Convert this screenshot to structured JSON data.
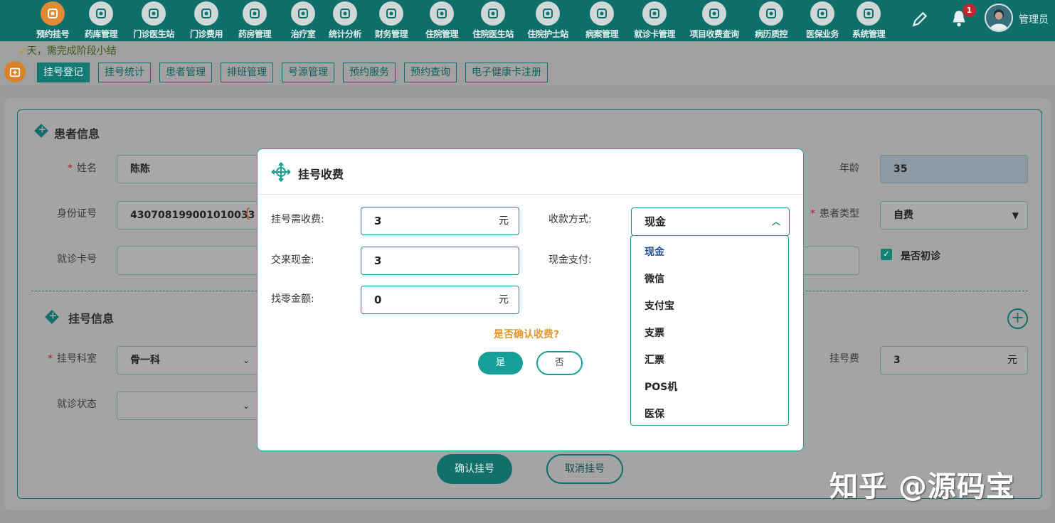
{
  "nav": {
    "items": [
      {
        "label": "预约挂号",
        "icon": "calendar-icon",
        "active": true
      },
      {
        "label": "药库管理",
        "icon": "warehouse-icon"
      },
      {
        "label": "门诊医生站",
        "icon": "doctor-icon"
      },
      {
        "label": "门诊费用",
        "icon": "yen-icon"
      },
      {
        "label": "药房管理",
        "icon": "pill-icon"
      },
      {
        "label": "治疗室",
        "icon": "nurse-icon"
      },
      {
        "label": "统计分析",
        "icon": "bar-chart-icon"
      },
      {
        "label": "财务管理",
        "icon": "gear-coin-icon"
      },
      {
        "label": "住院管理",
        "icon": "bed-icon"
      },
      {
        "label": "住院医生站",
        "icon": "doctor-card-icon"
      },
      {
        "label": "住院护士站",
        "icon": "nurse-card-icon"
      },
      {
        "label": "病案管理",
        "icon": "record-icon"
      },
      {
        "label": "就诊卡管理",
        "icon": "card-icon"
      },
      {
        "label": "项目收费查询",
        "icon": "bill-icon"
      },
      {
        "label": "病历质控",
        "icon": "quality-icon"
      },
      {
        "label": "医保业务",
        "icon": "insurance-icon"
      },
      {
        "label": "系统管理",
        "icon": "settings-icon"
      }
    ],
    "notification_count": "1",
    "user_name": "管理员"
  },
  "notice": "天，需完成阶段小结",
  "sub_tabs": [
    "挂号登记",
    "挂号统计",
    "患者管理",
    "排班管理",
    "号源管理",
    "预约服务",
    "预约查询",
    "电子健康卡注册"
  ],
  "patient": {
    "section_title": "患者信息",
    "name_label": "姓名",
    "name_value": "陈陈",
    "idcard_label": "身份证号",
    "idcard_value": "430708199001010033",
    "card_label": "就诊卡号",
    "card_value": "",
    "age_label": "年龄",
    "age_value": "35",
    "type_label": "患者类型",
    "type_value": "自费",
    "first_visit_label": "是否初诊",
    "first_visit_checked": true
  },
  "registration": {
    "section_title": "挂号信息",
    "dept_label": "挂号科室",
    "dept_value": "骨一科",
    "status_label": "就诊状态",
    "status_value": "",
    "fee_label": "挂号费",
    "fee_value": "3",
    "fee_unit": "元"
  },
  "actions": {
    "confirm": "确认挂号",
    "cancel": "取消挂号"
  },
  "modal": {
    "title": "挂号收费",
    "fee_label": "挂号需收费:",
    "fee_value": "3",
    "fee_unit": "元",
    "cash_in_label": "交来现金:",
    "cash_in_value": "3",
    "change_label": "找零金额:",
    "change_value": "0",
    "change_unit": "元",
    "pay_method_label": "收款方式:",
    "pay_method_value": "现金",
    "cash_pay_label": "现金支付:",
    "confirm_question": "是否确认收费?",
    "yes": "是",
    "no": "否",
    "options": [
      "现金",
      "微信",
      "支付宝",
      "支票",
      "汇票",
      "POS机",
      "医保"
    ]
  },
  "watermark": "知乎 @源码宝",
  "colors": {
    "nav_bg": "#0e6e6a",
    "accent": "#14a098",
    "active_icon": "#e28a34",
    "warning": "#e39a2e"
  }
}
